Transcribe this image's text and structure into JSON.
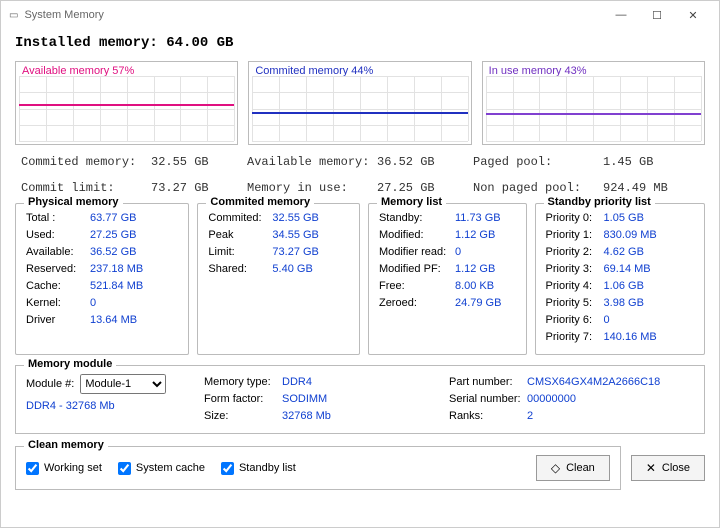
{
  "window": {
    "title": "System Memory"
  },
  "installed": {
    "label": "Installed memory:",
    "value": "64.00 GB"
  },
  "charts": [
    {
      "title": "Available memory 57%",
      "class": "pink",
      "color": "#e01080",
      "pct": 57
    },
    {
      "title": "Commited memory 44%",
      "class": "blue",
      "color": "#2030c0",
      "pct": 44
    },
    {
      "title": "In use memory 43%",
      "class": "purple",
      "color": "#8040d0",
      "pct": 43
    }
  ],
  "stats1": [
    {
      "label": "Commited memory:",
      "value": "32.55 GB"
    },
    {
      "label": "Available memory:",
      "value": "36.52 GB"
    },
    {
      "label": "Paged pool:",
      "value": "1.45 GB"
    }
  ],
  "stats2": [
    {
      "label": "Commit limit:",
      "value": "73.27 GB"
    },
    {
      "label": "Memory in use:",
      "value": "27.25 GB"
    },
    {
      "label": "Non paged pool:",
      "value": "924.49 MB"
    }
  ],
  "physical": {
    "title": "Physical memory",
    "items": [
      {
        "k": "Total :",
        "v": "63.77 GB"
      },
      {
        "k": "Used:",
        "v": "27.25 GB"
      },
      {
        "k": "Available:",
        "v": "36.52 GB"
      },
      {
        "k": "Reserved:",
        "v": "237.18 MB"
      },
      {
        "k": "Cache:",
        "v": "521.84 MB"
      },
      {
        "k": "Kernel:",
        "v": "0"
      },
      {
        "k": "Driver",
        "v": "13.64 MB"
      }
    ]
  },
  "commit_panel": {
    "title": "Commited memory",
    "items": [
      {
        "k": "Commited:",
        "v": "32.55 GB"
      },
      {
        "k": "Peak",
        "v": "34.55 GB"
      },
      {
        "k": "Limit:",
        "v": "73.27 GB"
      },
      {
        "k": "Shared:",
        "v": "5.40 GB"
      }
    ]
  },
  "memlist": {
    "title": "Memory list",
    "items": [
      {
        "k": "Standby:",
        "v": "11.73 GB"
      },
      {
        "k": "Modified:",
        "v": "1.12 GB"
      },
      {
        "k": "Modifier read:",
        "v": "0"
      },
      {
        "k": "Modified PF:",
        "v": "1.12 GB"
      },
      {
        "k": "Free:",
        "v": "8.00 KB"
      },
      {
        "k": "Zeroed:",
        "v": "24.79 GB"
      }
    ]
  },
  "standby": {
    "title": "Standby priority list",
    "items": [
      {
        "k": "Priority 0:",
        "v": "1.05 GB"
      },
      {
        "k": "Priority 1:",
        "v": "830.09 MB"
      },
      {
        "k": "Priority 2:",
        "v": "4.62 GB"
      },
      {
        "k": "Priority 3:",
        "v": "69.14 MB"
      },
      {
        "k": "Priority 4:",
        "v": "1.06 GB"
      },
      {
        "k": "Priority 5:",
        "v": "3.98 GB"
      },
      {
        "k": "Priority 6:",
        "v": "0"
      },
      {
        "k": "Priority 7:",
        "v": "140.16 MB"
      }
    ]
  },
  "module": {
    "title": "Memory module",
    "slot_label": "Module #:",
    "selected": "Module-1",
    "options": [
      "Module-1"
    ],
    "slot_desc": "DDR4 - 32768 Mb",
    "cols": [
      [
        {
          "k": "Memory type:",
          "v": "DDR4"
        },
        {
          "k": "Form factor:",
          "v": "SODIMM"
        },
        {
          "k": "Size:",
          "v": "32768 Mb"
        }
      ],
      [
        {
          "k": "Part number:",
          "v": "CMSX64GX4M2A2666C18"
        },
        {
          "k": "Serial number:",
          "v": "00000000"
        },
        {
          "k": "Ranks:",
          "v": "2"
        }
      ]
    ]
  },
  "clean": {
    "title": "Clean memory",
    "checks": [
      {
        "label": "Working set",
        "checked": true
      },
      {
        "label": "System cache",
        "checked": true
      },
      {
        "label": "Standby list",
        "checked": true
      }
    ],
    "clean_btn": "Clean",
    "close_btn": "Close"
  },
  "chart_data": [
    {
      "type": "line",
      "title": "Available memory 57%",
      "values": [
        57,
        57,
        57,
        57,
        57,
        57,
        57,
        57,
        57,
        57
      ],
      "ylim": [
        0,
        100
      ]
    },
    {
      "type": "line",
      "title": "Commited memory 44%",
      "values": [
        44,
        44,
        44,
        44,
        44,
        44,
        44,
        44,
        44,
        44
      ],
      "ylim": [
        0,
        100
      ]
    },
    {
      "type": "line",
      "title": "In use memory 43%",
      "values": [
        43,
        43,
        43,
        43,
        43,
        43,
        43,
        43,
        43,
        43
      ],
      "ylim": [
        0,
        100
      ]
    }
  ]
}
